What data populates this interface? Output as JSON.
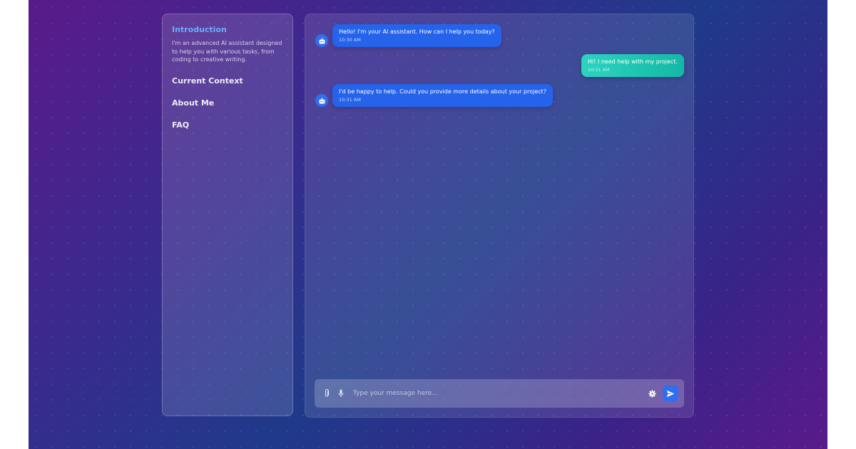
{
  "colors": {
    "accent": "#6aaefc",
    "ai_bubble": "#2563eb",
    "user_bubble": "#14b8a6",
    "send_button": "#2f6ef0"
  },
  "sidebar": {
    "items": [
      {
        "label": "Introduction",
        "active": true,
        "description": "I'm an advanced AI assistant designed to help you with various tasks, from coding to creative writing."
      },
      {
        "label": "Current Context",
        "active": false
      },
      {
        "label": "About Me",
        "active": false
      },
      {
        "label": "FAQ",
        "active": false
      }
    ]
  },
  "chat": {
    "messages": [
      {
        "sender": "ai",
        "icon": "robot-icon",
        "text": "Hello! I'm your AI assistant. How can I help you today?",
        "time": "10:30 AM"
      },
      {
        "sender": "user",
        "text": "Hi! I need help with my project.",
        "time": "10:31 AM"
      },
      {
        "sender": "ai",
        "icon": "robot-icon",
        "text": "I'd be happy to help. Could you provide more details about your project?",
        "time": "10:31 AM"
      }
    ]
  },
  "input": {
    "placeholder": "Type your message here...",
    "value": "",
    "left_icons": [
      "paperclip-icon",
      "microphone-icon"
    ],
    "right_icons": [
      "gear-icon",
      "send-icon"
    ]
  }
}
